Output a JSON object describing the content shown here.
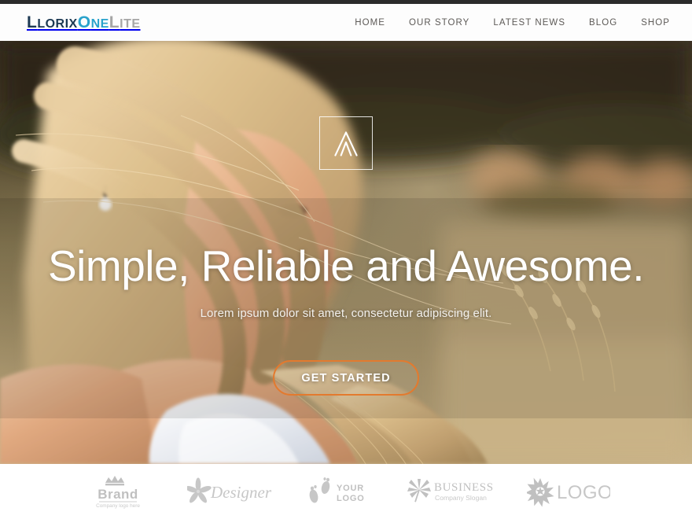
{
  "site": {
    "logo": {
      "part1": "Llorix",
      "part2": "One",
      "part3": "Lite"
    },
    "colors": {
      "logo_dark": "#1d3a54",
      "logo_cyan": "#2aa3cc",
      "logo_gray": "#a6a6a6",
      "accent_orange": "#e37a2e",
      "topbar": "#2b2b2b",
      "nav_text": "#5d5a57"
    }
  },
  "nav": {
    "items": [
      {
        "label": "HOME"
      },
      {
        "label": "OUR STORY"
      },
      {
        "label": "LATEST NEWS"
      },
      {
        "label": "BLOG"
      },
      {
        "label": "SHOP"
      }
    ]
  },
  "hero": {
    "mark_icon": "chevron-a-mark-icon",
    "headline": "Simple, Reliable and Awesome.",
    "subheadline": "Lorem ipsum dolor sit amet, consectetur adipiscing elit.",
    "cta_label": "GET STARTED",
    "background_description": "Blonde woman portrait in a sunlit field"
  },
  "clients": {
    "items": [
      {
        "icon": "crown-icon",
        "name": "Brand",
        "tagline": "Company logo here"
      },
      {
        "icon": "flower-icon",
        "name": "Designer",
        "tagline": ""
      },
      {
        "icon": "footprints-icon",
        "name": "YOUR",
        "tagline": "LOGO"
      },
      {
        "icon": "leaf-icon",
        "name": "BUSINESS",
        "tagline": "Company Slogan"
      },
      {
        "icon": "starburst-icon",
        "name": "LOGO",
        "tagline": ""
      }
    ]
  }
}
